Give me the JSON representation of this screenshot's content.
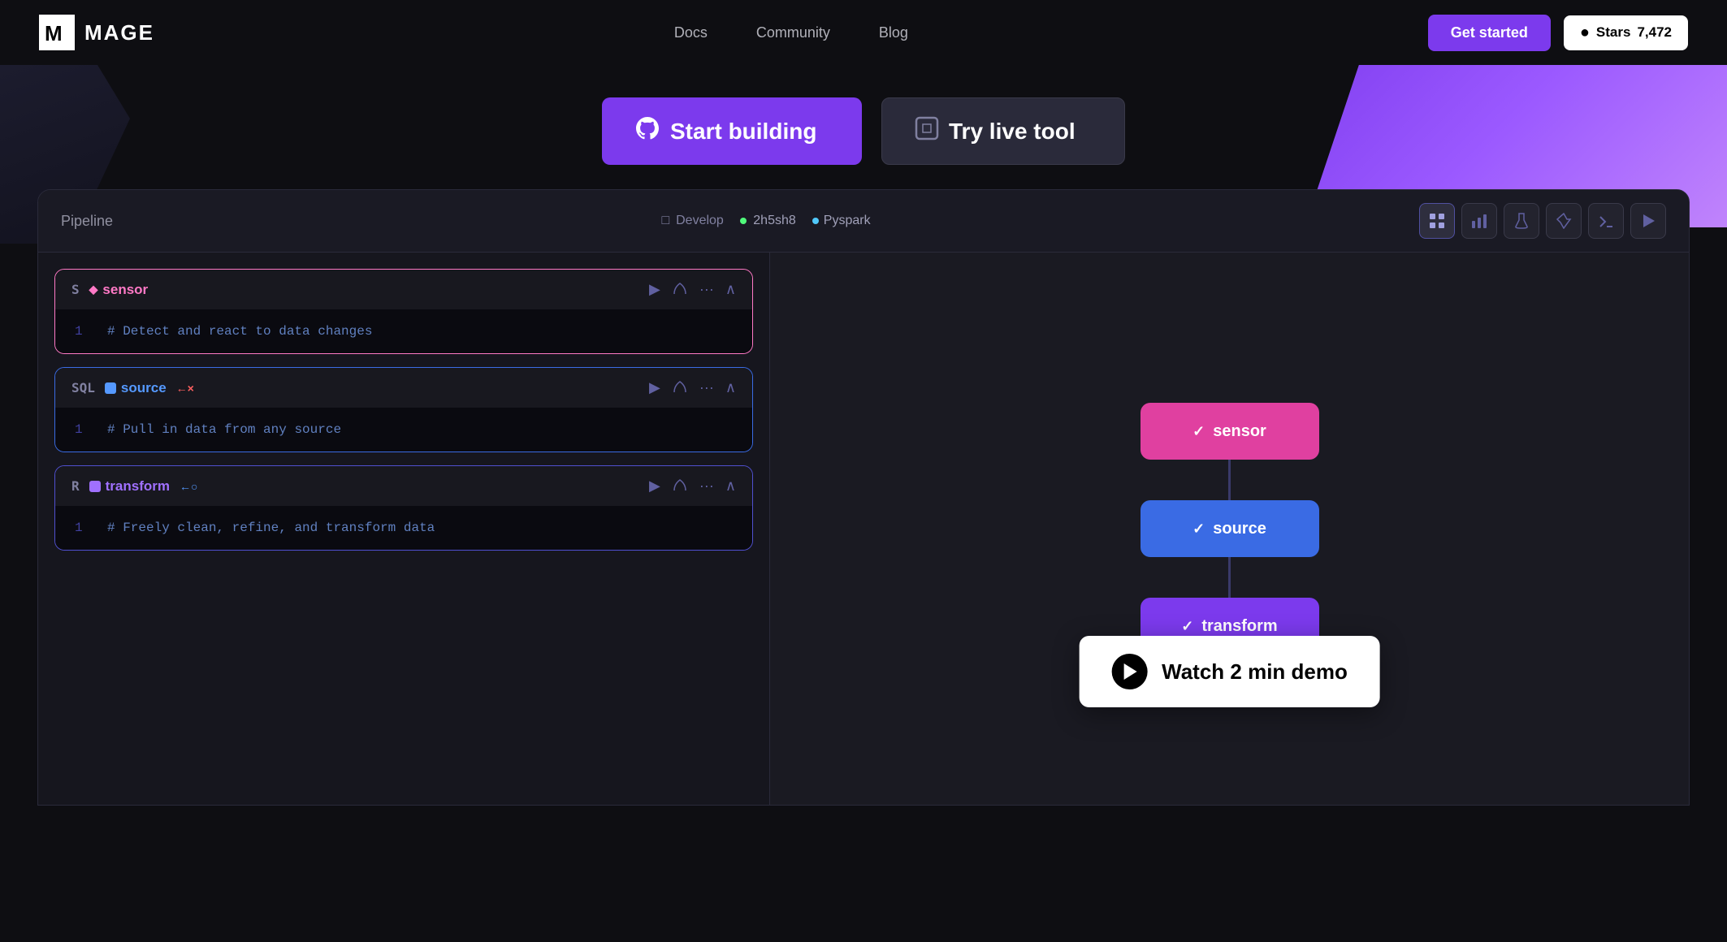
{
  "header": {
    "logo_text": "MAGE",
    "nav": {
      "docs": "Docs",
      "community": "Community",
      "blog": "Blog"
    },
    "get_started": "Get started",
    "github_stars_label": "Stars",
    "github_stars_count": "7,472"
  },
  "hero": {
    "btn_start_building": "Start building",
    "btn_try_live": "Try live tool"
  },
  "pipeline": {
    "title": "Pipeline",
    "develop_label": "Develop",
    "hash": "2h5sh8",
    "env": "Pyspark",
    "blocks": [
      {
        "type": "S",
        "icon": "diamond",
        "name": "sensor",
        "color": "pink",
        "code": "# Detect and react to data changes",
        "line_num": "1"
      },
      {
        "type": "SQL",
        "icon": "square-blue",
        "name": "source",
        "color": "blue",
        "conn_icon": "←×",
        "code": "# Pull in data from any source",
        "line_num": "1"
      },
      {
        "type": "R",
        "icon": "square-purple",
        "name": "transform",
        "color": "purple",
        "conn_icon": "←○",
        "code": "# Freely clean, refine, and transform data",
        "line_num": "1"
      }
    ],
    "flow_nodes": [
      {
        "label": "sensor",
        "type": "sensor"
      },
      {
        "label": "source",
        "type": "source"
      },
      {
        "label": "transform",
        "type": "transform"
      }
    ],
    "watch_demo": "Watch 2 min demo"
  }
}
